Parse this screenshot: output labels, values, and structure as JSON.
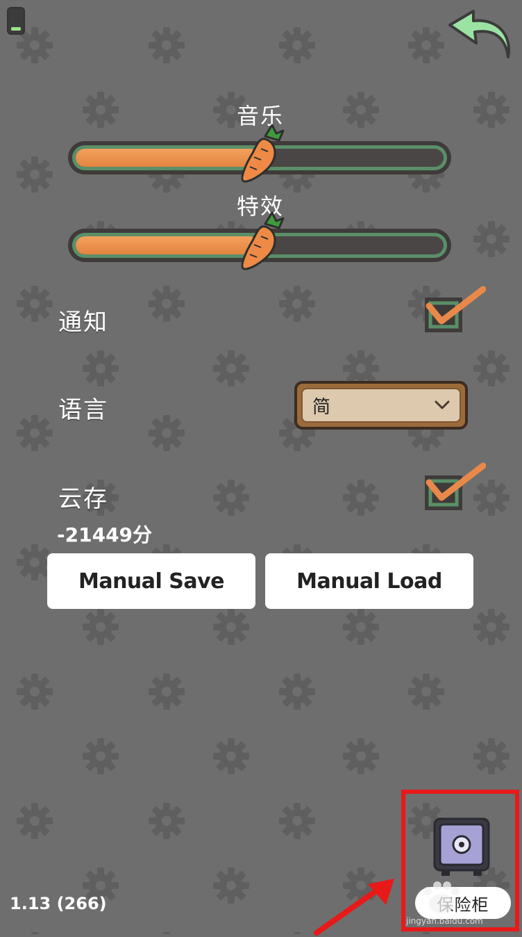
{
  "settings": {
    "music": {
      "label": "音乐",
      "level": 0.5
    },
    "effects": {
      "label": "特效",
      "level": 0.5
    },
    "notification": {
      "label": "通知",
      "checked": true
    },
    "language": {
      "label": "语言",
      "selected": "简"
    },
    "cloud_save": {
      "label": "云存",
      "checked": true
    },
    "score": "-21449分",
    "buttons": {
      "save_label": "Manual Save",
      "load_label": "Manual Load"
    }
  },
  "footer": {
    "version": "1.13 (266)"
  },
  "safe": {
    "label": "保险柜"
  },
  "watermark": {
    "text": "jingyan.baidu.com"
  },
  "colors": {
    "background": "#6e6e6e",
    "slider_fill": "#e8894a",
    "slider_border": "#5a8f68",
    "checkbox_border": "#5a8f68",
    "checkmark": "#e8894a",
    "highlight_frame": "#e81919"
  },
  "icons": {
    "back": "back-arrow-icon",
    "battery": "battery-icon",
    "carrot": "carrot-handle-icon",
    "checkmark": "checkmark-icon",
    "chevron": "chevron-down-icon",
    "safe": "safe-icon",
    "annotation": "red-arrow-icon",
    "background": "gear-icon"
  }
}
